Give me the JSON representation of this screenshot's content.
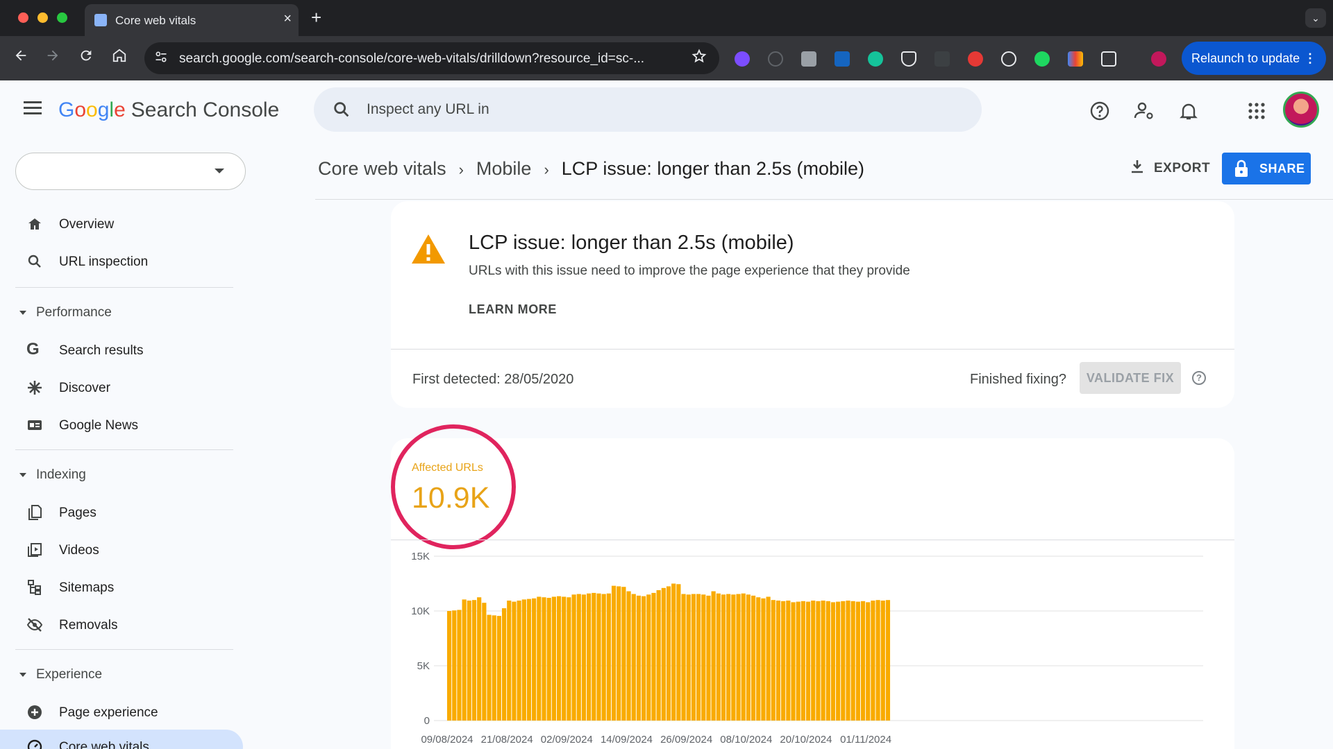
{
  "browser": {
    "tab_title": "Core web vitals",
    "tab_close": "×",
    "new_tab": "+",
    "tab_search": "⌄",
    "url": "search.google.com/search-console/core-web-vitals/drilldown?resource_id=sc-...",
    "relaunch_label": "Relaunch to update",
    "colors": {
      "frame": "#202124",
      "toolbar": "#35363a",
      "relaunch": "#0b57d0"
    }
  },
  "header": {
    "logo_letters": [
      "G",
      "o",
      "o",
      "g",
      "l",
      "e"
    ],
    "logo_product": "Search Console",
    "search_placeholder": "Inspect any URL in"
  },
  "sidebar": {
    "property_value": "",
    "items": [
      {
        "label": "Overview",
        "icon": "home-icon"
      },
      {
        "label": "URL inspection",
        "icon": "search-icon"
      }
    ],
    "sections": [
      {
        "title": "Performance",
        "items": [
          {
            "label": "Search results",
            "icon": "google-g-icon"
          },
          {
            "label": "Discover",
            "icon": "asterisk-icon"
          },
          {
            "label": "Google News",
            "icon": "news-icon"
          }
        ]
      },
      {
        "title": "Indexing",
        "items": [
          {
            "label": "Pages",
            "icon": "pages-icon"
          },
          {
            "label": "Videos",
            "icon": "video-icon"
          },
          {
            "label": "Sitemaps",
            "icon": "sitemap-icon"
          },
          {
            "label": "Removals",
            "icon": "eye-off-icon"
          }
        ]
      },
      {
        "title": "Experience",
        "items": [
          {
            "label": "Page experience",
            "icon": "plus-circle-icon"
          },
          {
            "label": "Core web vitals",
            "icon": "gauge-icon",
            "active": true
          }
        ]
      }
    ]
  },
  "breadcrumb": {
    "items": [
      "Core web vitals",
      "Mobile",
      "LCP issue: longer than 2.5s (mobile)"
    ],
    "separator": "›"
  },
  "actions": {
    "export_label": "EXPORT",
    "share_label": "SHARE"
  },
  "issue": {
    "title": "LCP issue: longer than 2.5s (mobile)",
    "description": "URLs with this issue need to improve the page experience that they provide",
    "learn_more": "LEARN MORE",
    "first_detected": "First detected: 28/05/2020",
    "finished_fixing": "Finished fixing?",
    "validate_fix": "VALIDATE FIX",
    "help": "?",
    "icon": "warning-icon",
    "warning_color": "#f29900"
  },
  "affected": {
    "label": "Affected URLs",
    "value": "10.9K",
    "color": "#e8a317",
    "highlight_color": "#e0245e"
  },
  "chart_data": {
    "type": "bar",
    "ylim": [
      0,
      15000
    ],
    "y_ticks": [
      "0",
      "5K",
      "10K",
      "15K"
    ],
    "x_tick_labels": [
      "09/08/2024",
      "21/08/2024",
      "02/09/2024",
      "14/09/2024",
      "26/09/2024",
      "08/10/2024",
      "20/10/2024",
      "01/11/2024"
    ],
    "bar_color": "#f9ab00",
    "start_date": "09/08/2024",
    "values": [
      10000,
      10050,
      10100,
      11050,
      10950,
      11000,
      11250,
      10750,
      9650,
      9600,
      9550,
      10250,
      10950,
      10850,
      10950,
      11050,
      11100,
      11150,
      11300,
      11250,
      11200,
      11300,
      11350,
      11300,
      11250,
      11500,
      11550,
      11500,
      11600,
      11650,
      11600,
      11550,
      11600,
      12300,
      12250,
      12200,
      11800,
      11550,
      11400,
      11350,
      11500,
      11650,
      11900,
      12100,
      12250,
      12500,
      12450,
      11550,
      11500,
      11550,
      11550,
      11500,
      11400,
      11800,
      11600,
      11500,
      11550,
      11500,
      11550,
      11600,
      11500,
      11400,
      11250,
      11150,
      11300,
      11000,
      10950,
      10900,
      10950,
      10800,
      10850,
      10900,
      10850,
      10950,
      10900,
      10950,
      10900,
      10800,
      10850,
      10900,
      10950,
      10900,
      10850,
      10900,
      10800,
      10950,
      11000,
      10950,
      11000
    ]
  }
}
